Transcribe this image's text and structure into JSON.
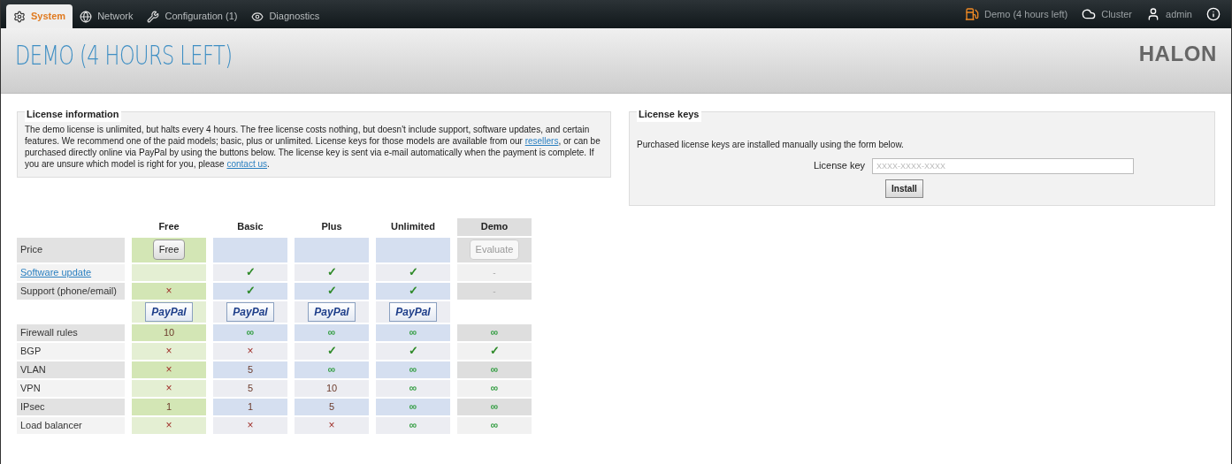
{
  "nav": {
    "tabs": [
      {
        "label": "System",
        "selected": true
      },
      {
        "label": "Network",
        "selected": false
      },
      {
        "label": "Configuration (1)",
        "selected": false
      },
      {
        "label": "Diagnostics",
        "selected": false
      }
    ],
    "right": [
      {
        "label": "Demo (4 hours left)"
      },
      {
        "label": "Cluster"
      },
      {
        "label": "admin"
      }
    ]
  },
  "header": {
    "title": "DEMO (4 HOURS LEFT)",
    "logo": "HALON"
  },
  "license_info": {
    "title": "License information",
    "parts": [
      {
        "kind": "text",
        "text": "The demo license is unlimited, but halts every 4 hours. The free license costs nothing, but doesn't include support, software updates, and certain features. We recommend one of the paid models; basic, plus or unlimited. License keys for those models are available from our "
      },
      {
        "kind": "link",
        "text": "resellers"
      },
      {
        "kind": "text",
        "text": ", or can be purchased directly online via PayPal by using the buttons below. The license key is sent via e-mail automatically when the payment is complete. If you are unsure which model is right for you, please "
      },
      {
        "kind": "link",
        "text": "contact us"
      },
      {
        "kind": "text",
        "text": "."
      }
    ]
  },
  "license_keys": {
    "title": "License keys",
    "description": "Purchased license keys are installed manually using the form below.",
    "field_label": "License key",
    "placeholder": "XXXX-XXXX-XXXX",
    "button": "Install"
  },
  "table": {
    "columns": [
      {
        "name": "Free",
        "kind": "free"
      },
      {
        "name": "Basic",
        "kind": "plan"
      },
      {
        "name": "Plus",
        "kind": "plan"
      },
      {
        "name": "Unlimited",
        "kind": "plan"
      },
      {
        "name": "Demo",
        "kind": "demo"
      }
    ],
    "rows": [
      {
        "label": "Price",
        "link": false,
        "cells": [
          {
            "kind": "button",
            "text": "Free",
            "disabled": false
          },
          {
            "kind": "empty"
          },
          {
            "kind": "empty"
          },
          {
            "kind": "empty"
          },
          {
            "kind": "button",
            "text": "Evaluate",
            "disabled": true
          }
        ]
      },
      {
        "label": "Software update",
        "link": true,
        "cells": [
          {
            "kind": "empty"
          },
          {
            "kind": "check",
            "text": "✓"
          },
          {
            "kind": "check",
            "text": "✓"
          },
          {
            "kind": "check",
            "text": "✓"
          },
          {
            "kind": "dash",
            "text": "-"
          }
        ]
      },
      {
        "label": "Support (phone/email)",
        "link": false,
        "cells": [
          {
            "kind": "cross",
            "text": "×"
          },
          {
            "kind": "check",
            "text": "✓"
          },
          {
            "kind": "check",
            "text": "✓"
          },
          {
            "kind": "check",
            "text": "✓"
          },
          {
            "kind": "dash",
            "text": "-"
          }
        ]
      },
      {
        "cells": [
          {
            "kind": "paypal",
            "text": "PayPal"
          },
          {
            "kind": "paypal",
            "text": "PayPal"
          },
          {
            "kind": "paypal",
            "text": "PayPal"
          },
          {
            "kind": "paypal",
            "text": "PayPal"
          },
          {
            "kind": "none"
          }
        ]
      },
      {
        "label": "Firewall rules",
        "link": false,
        "cells": [
          {
            "kind": "number",
            "text": "10"
          },
          {
            "kind": "infinity",
            "text": "∞"
          },
          {
            "kind": "infinity",
            "text": "∞"
          },
          {
            "kind": "infinity",
            "text": "∞"
          },
          {
            "kind": "infinity",
            "text": "∞"
          }
        ]
      },
      {
        "label": "BGP",
        "link": false,
        "cells": [
          {
            "kind": "cross",
            "text": "×"
          },
          {
            "kind": "cross",
            "text": "×"
          },
          {
            "kind": "check",
            "text": "✓"
          },
          {
            "kind": "check",
            "text": "✓"
          },
          {
            "kind": "check",
            "text": "✓"
          }
        ]
      },
      {
        "label": "VLAN",
        "link": false,
        "cells": [
          {
            "kind": "cross",
            "text": "×"
          },
          {
            "kind": "number",
            "text": "5"
          },
          {
            "kind": "infinity",
            "text": "∞"
          },
          {
            "kind": "infinity",
            "text": "∞"
          },
          {
            "kind": "infinity",
            "text": "∞"
          }
        ]
      },
      {
        "label": "VPN",
        "link": false,
        "cells": [
          {
            "kind": "cross",
            "text": "×"
          },
          {
            "kind": "number",
            "text": "5"
          },
          {
            "kind": "number",
            "text": "10"
          },
          {
            "kind": "infinity",
            "text": "∞"
          },
          {
            "kind": "infinity",
            "text": "∞"
          }
        ]
      },
      {
        "label": "IPsec",
        "link": false,
        "cells": [
          {
            "kind": "number",
            "text": "1"
          },
          {
            "kind": "number",
            "text": "1"
          },
          {
            "kind": "number",
            "text": "5"
          },
          {
            "kind": "infinity",
            "text": "∞"
          },
          {
            "kind": "infinity",
            "text": "∞"
          }
        ]
      },
      {
        "label": "Load balancer",
        "link": false,
        "cells": [
          {
            "kind": "cross",
            "text": "×"
          },
          {
            "kind": "cross",
            "text": "×"
          },
          {
            "kind": "cross",
            "text": "×"
          },
          {
            "kind": "infinity",
            "text": "∞"
          },
          {
            "kind": "infinity",
            "text": "∞"
          }
        ]
      }
    ]
  }
}
